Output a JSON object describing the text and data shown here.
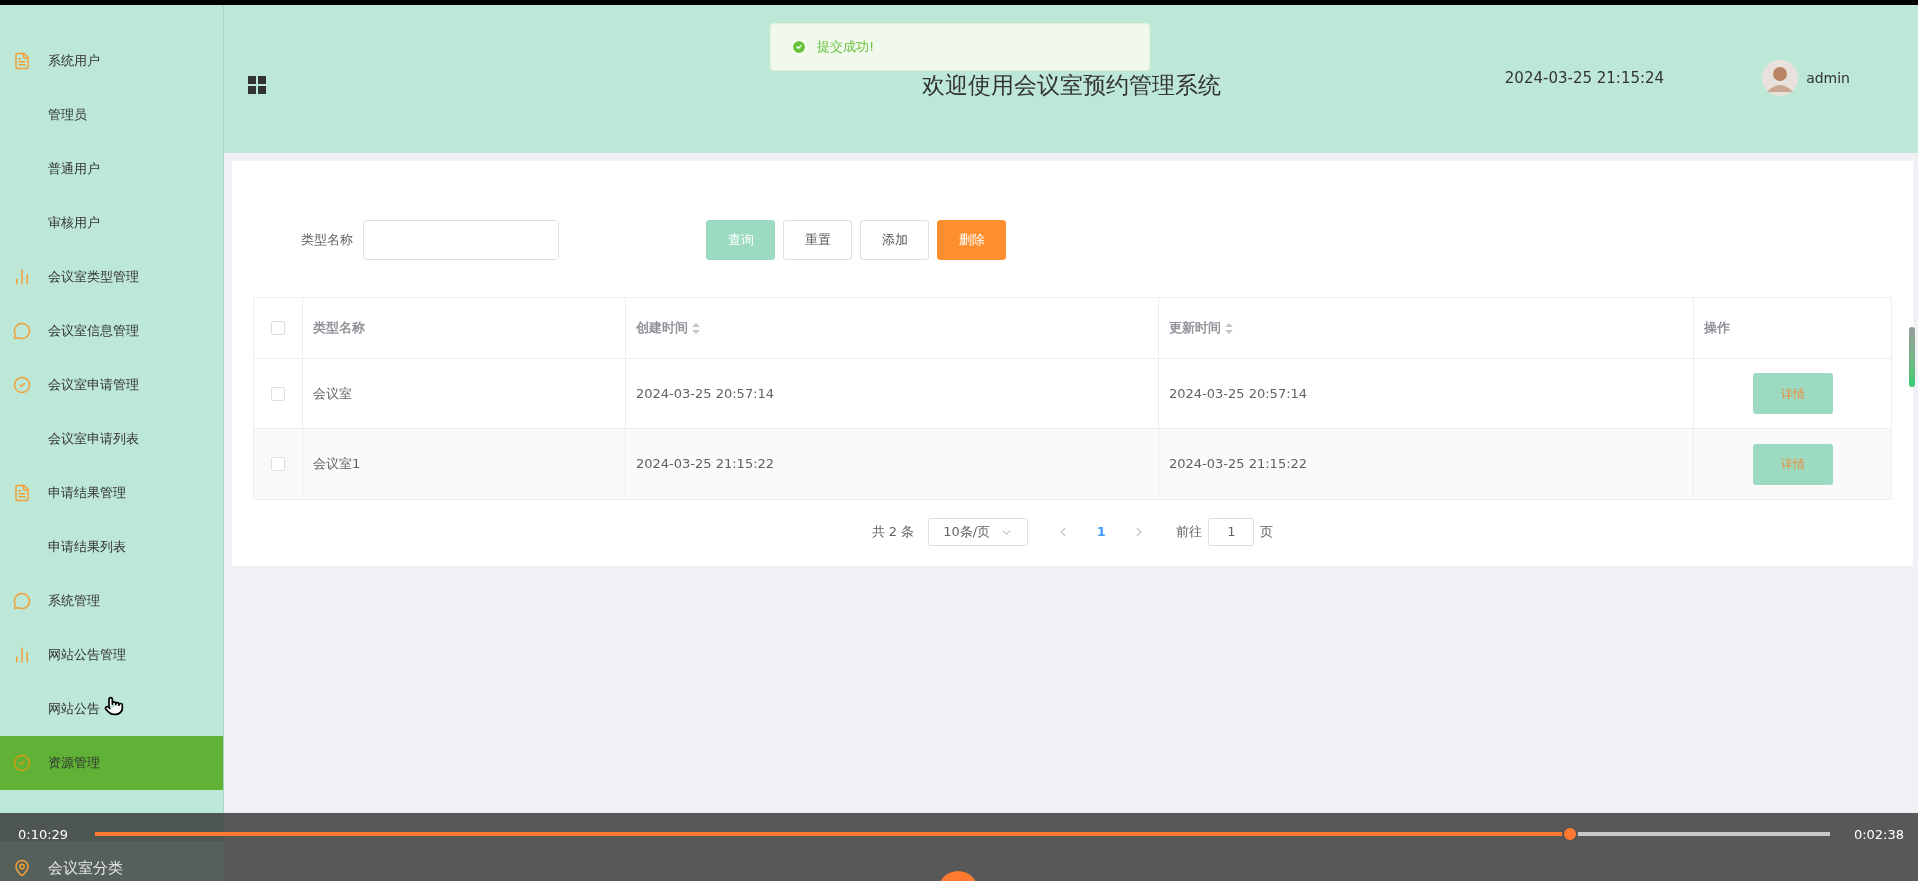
{
  "sidebar": {
    "items": [
      {
        "label": "系统用户",
        "selected": false,
        "children": [
          {
            "label": "管理员",
            "selected": false
          },
          {
            "label": "普通用户",
            "selected": false
          },
          {
            "label": "审核用户",
            "selected": false
          }
        ]
      },
      {
        "label": "会议室类型管理",
        "selected": false
      },
      {
        "label": "会议室信息管理",
        "selected": false
      },
      {
        "label": "会议室申请管理",
        "selected": false,
        "children": [
          {
            "label": "会议室申请列表",
            "selected": false
          }
        ]
      },
      {
        "label": "申请结果管理",
        "selected": false,
        "children": [
          {
            "label": "申请结果列表",
            "selected": false
          }
        ]
      },
      {
        "label": "系统管理",
        "selected": false
      },
      {
        "label": "网站公告管理",
        "selected": false,
        "children": [
          {
            "label": "网站公告",
            "selected": false
          }
        ]
      },
      {
        "label": "资源管理",
        "selected": true
      },
      {
        "label": "会议室分类",
        "selected": false
      }
    ]
  },
  "header": {
    "title": "欢迎使用会议室预约管理系统",
    "datetime": "2024-03-25 21:15:24",
    "user": "admin"
  },
  "toast": {
    "kind": "success",
    "message": "提交成功!"
  },
  "search": {
    "label": "类型名称"
  },
  "buttons": [
    {
      "label": "查询",
      "kind": "primary"
    },
    {
      "label": "重置",
      "kind": "default"
    },
    {
      "label": "添加",
      "kind": "default"
    },
    {
      "label": "删除",
      "kind": "danger"
    }
  ],
  "table": {
    "header_checked": false,
    "columns": [
      {
        "label": "类型名称",
        "sortable": false
      },
      {
        "label": "创建时间",
        "sortable": true
      },
      {
        "label": "更新时间",
        "sortable": true
      },
      {
        "label": "操作",
        "sortable": false
      }
    ],
    "rows": [
      {
        "checked": false,
        "cells": [
          "会议室",
          "2024-03-25 20:57:14",
          "2024-03-25 20:57:14"
        ],
        "action": "详情"
      },
      {
        "checked": false,
        "cells": [
          "会议室1",
          "2024-03-25 21:15:22",
          "2024-03-25 21:15:22"
        ],
        "action": "详情"
      }
    ]
  },
  "pagination": {
    "total": "共 2 条",
    "page_size": "10条/页",
    "pages": [
      {
        "label": "1",
        "selected": true
      }
    ],
    "goto_label": "前往",
    "goto_value": "1",
    "goto_suffix": "页"
  },
  "player": {
    "current": "0:10:29",
    "duration": "0:02:38",
    "level": 0.85
  }
}
